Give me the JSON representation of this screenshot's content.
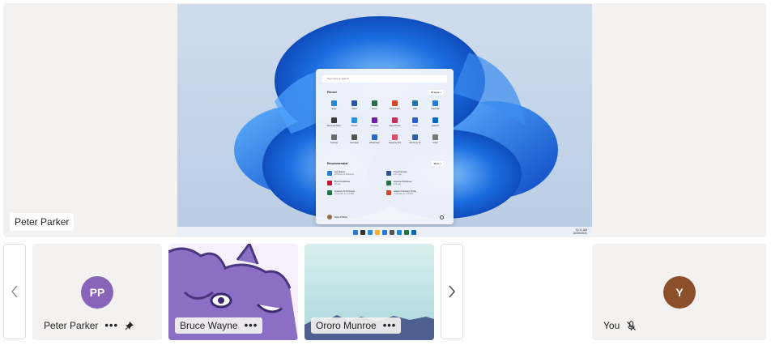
{
  "stage": {
    "speaker_name": "Peter Parker",
    "shared_screen": {
      "search_placeholder": "Type here to search",
      "pinned_label": "Pinned",
      "all_apps_label": "All apps  >",
      "recommended_label": "Recommended",
      "more_label": "More  >",
      "apps": [
        {
          "name": "Edge",
          "color": "#1f8ad6"
        },
        {
          "name": "Word",
          "color": "#2b579a"
        },
        {
          "name": "Excel",
          "color": "#217346"
        },
        {
          "name": "PowerPoint",
          "color": "#d24726"
        },
        {
          "name": "Mail",
          "color": "#1b75bb"
        },
        {
          "name": "Calendar",
          "color": "#2a7bd5"
        },
        {
          "name": "Microsoft Store",
          "color": "#3a3a3a"
        },
        {
          "name": "Photos",
          "color": "#2e8fd8"
        },
        {
          "name": "OneNote",
          "color": "#7719aa"
        },
        {
          "name": "Xbox Photos",
          "color": "#c2305b"
        },
        {
          "name": "To Do",
          "color": "#2564cf"
        },
        {
          "name": "LinkedIn",
          "color": "#0a66c2"
        },
        {
          "name": "Settings",
          "color": "#6b6b6b"
        },
        {
          "name": "Calculator",
          "color": "#555"
        },
        {
          "name": "Whiteboard",
          "color": "#1c6fd1"
        },
        {
          "name": "Snipping Tool",
          "color": "#d94f70"
        },
        {
          "name": "Movies & TV",
          "color": "#2a5fb8"
        },
        {
          "name": "Clock",
          "color": "#777"
        }
      ],
      "recommended": [
        {
          "title": "Get Started",
          "sub": "Welcome to Windows",
          "color": "#2a7bd5"
        },
        {
          "title": "Travel Itinerary",
          "sub": "17m ago",
          "color": "#2b579a"
        },
        {
          "title": "Brand Guidelines",
          "sub": "2h ago",
          "color": "#c8102e"
        },
        {
          "title": "Expense Worksheet",
          "sub": "12h ago",
          "color": "#217346"
        },
        {
          "title": "Quarterly Profit Report",
          "sub": "Yesterday at 4:24 PM",
          "color": "#217346"
        },
        {
          "title": "Adatum Company Profile",
          "sub": "Yesterday at 1:15 PM",
          "color": "#d24726"
        }
      ],
      "user_name": "Sara Philips",
      "tray_time": "11:11 AM",
      "tray_date": "10/20/2021",
      "taskbar_icons": [
        "#2a7bd5",
        "#333",
        "#2e8fd8",
        "#f3b42b",
        "#2a7bd5",
        "#555",
        "#1f8ad6",
        "#217346",
        "#0a66c2"
      ]
    }
  },
  "participants": [
    {
      "name": "Peter Parker",
      "initials": "PP",
      "avatar_color": "#8764b8",
      "more": "•••",
      "pinned": true
    },
    {
      "name": "Bruce Wayne",
      "more": "•••",
      "background": "purple-creature"
    },
    {
      "name": "Ororo Munroe",
      "more": "•••",
      "background": "teal-mist"
    }
  ],
  "self": {
    "name": "You",
    "initials": "Y",
    "avatar_color": "#8b4f2a",
    "muted": true
  },
  "nav": {
    "prev_icon": "chevron-left-icon",
    "next_icon": "chevron-right-icon"
  }
}
